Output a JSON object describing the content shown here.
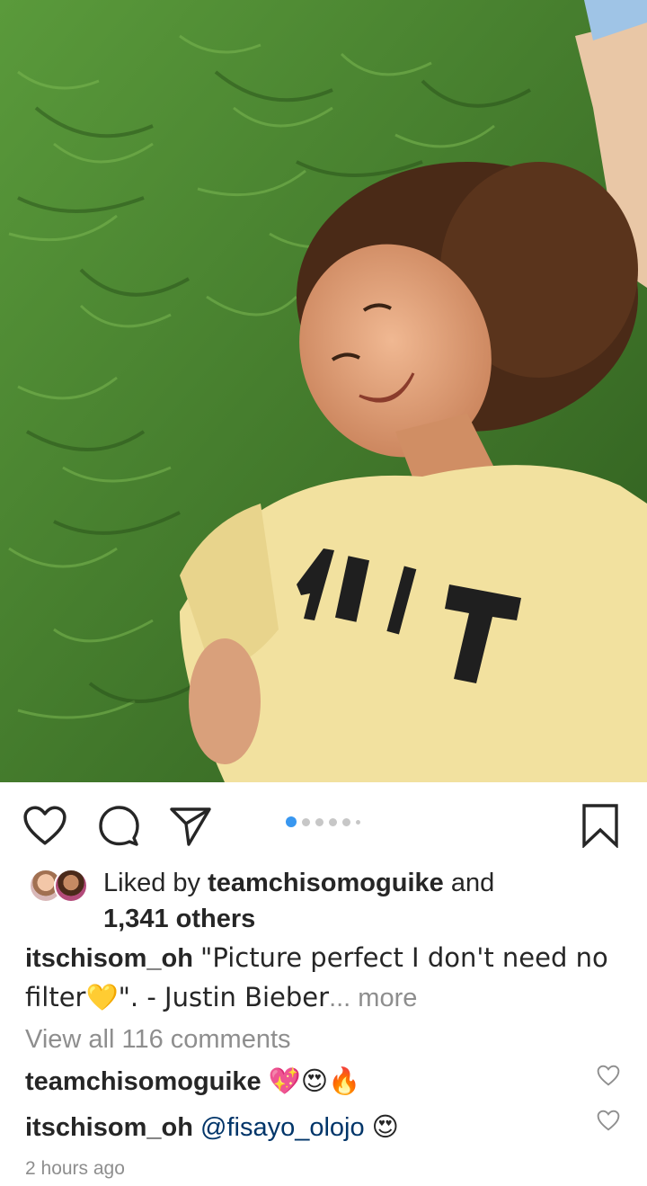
{
  "post": {
    "carousel": {
      "count": 6,
      "active_index": 0
    },
    "likes": {
      "prefix": "Liked by",
      "user": "teamchisomoguike",
      "connector": "and",
      "others": "1,341 others"
    },
    "caption": {
      "username": "itschisom_oh",
      "text": "\"Picture perfect I don't need no filter💛\". - Justin Bieber",
      "more": "... more"
    },
    "view_all_comments": "View all 116 comments",
    "comments": [
      {
        "username": "teamchisomoguike",
        "text": "💖😍🔥"
      },
      {
        "username": "itschisom_oh",
        "mention": "@fisayo_olojo",
        "text": "😍"
      }
    ],
    "timestamp": "2 hours ago"
  },
  "icons": {
    "like": "heart-outline-icon",
    "comment": "comment-bubble-icon",
    "share": "paper-plane-icon",
    "save": "bookmark-icon"
  },
  "colors": {
    "accent": "#3897f0",
    "muted": "#8e8e8e",
    "text": "#262626",
    "mention": "#003569"
  }
}
